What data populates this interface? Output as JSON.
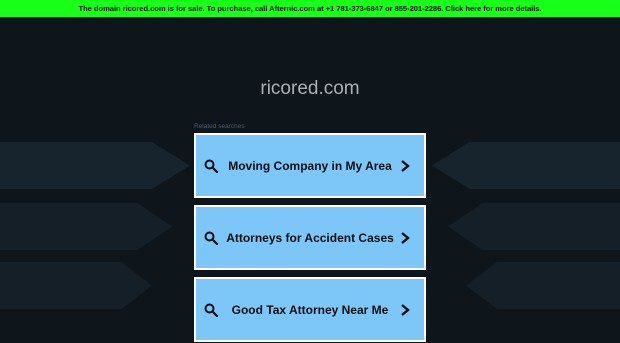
{
  "banner": {
    "text": "The domain ricored.com is for sale. To purchase, call Afternic.com at +1 781-373-6847 or 855-201-2286. Click here for more details."
  },
  "domain": {
    "title": "ricored.com"
  },
  "related": {
    "label": "Related searches",
    "items": [
      {
        "label": "Moving Company in My Area"
      },
      {
        "label": "Attorneys for Accident Cases"
      },
      {
        "label": "Good Tax Attorney Near Me"
      }
    ]
  },
  "icons": {
    "search": "search-icon",
    "chevron": "chevron-right-icon"
  },
  "colors": {
    "banner_bg": "#18ff18",
    "page_bg": "#0e151b",
    "link_bg": "#7cc7f7",
    "link_border": "#ffffff"
  }
}
